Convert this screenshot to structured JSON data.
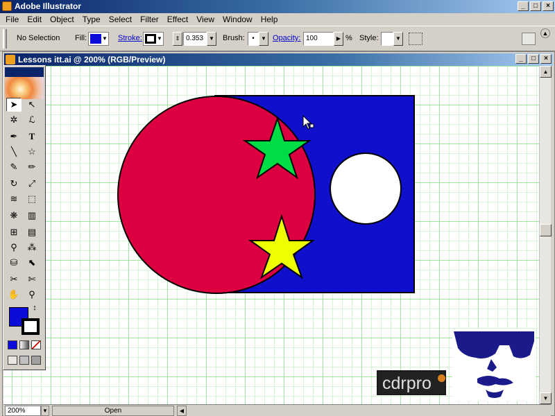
{
  "app": {
    "title": "Adobe Illustrator"
  },
  "window_buttons": {
    "minimize": "_",
    "restore": "□",
    "close": "×"
  },
  "menu": [
    "File",
    "Edit",
    "Object",
    "Type",
    "Select",
    "Filter",
    "Effect",
    "View",
    "Window",
    "Help"
  ],
  "control_bar": {
    "selection_label": "No Selection",
    "fill_label": "Fill:",
    "fill_color": "#0c0cd8",
    "stroke_label": "Stroke:",
    "stroke_weight": "0.353",
    "brush_label": "Brush:",
    "brush_value": "•",
    "opacity_label": "Opacity:",
    "opacity_value": "100",
    "opacity_unit": "%",
    "style_label": "Style:"
  },
  "document": {
    "title": "Lessons itt.ai @ 200% (RGB/Preview)",
    "zoom": "200%",
    "status": "Open"
  },
  "artwork": {
    "rect_color": "#1010cc",
    "circle_color": "#dc0040",
    "top_star_color": "#00dd44",
    "bottom_star_color": "#eeff00",
    "hole_color": "#ffffff"
  },
  "watermark": {
    "text": "cdrpro"
  },
  "tools": {
    "fill_color": "#0c0cd8",
    "stroke_color": "#000000"
  }
}
